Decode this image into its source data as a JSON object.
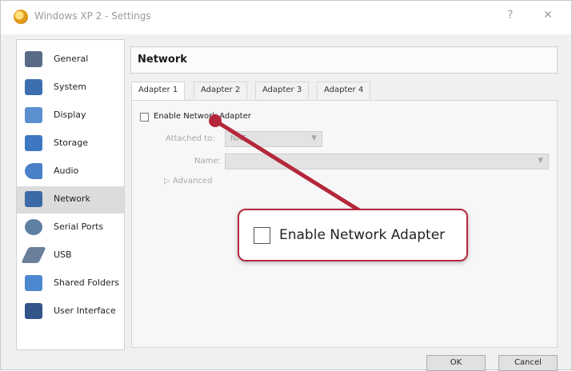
{
  "window": {
    "title": "Windows XP 2 - Settings",
    "help_glyph": "?",
    "close_glyph": "✕"
  },
  "sidebar": {
    "items": [
      {
        "label": "General",
        "icon": "general-icon",
        "color": "#5a6b86"
      },
      {
        "label": "System",
        "icon": "system-icon",
        "color": "#3d6fb0"
      },
      {
        "label": "Display",
        "icon": "display-icon",
        "color": "#5b8fcf"
      },
      {
        "label": "Storage",
        "icon": "storage-icon",
        "color": "#3f78c2"
      },
      {
        "label": "Audio",
        "icon": "audio-icon",
        "color": "#4a80c8"
      },
      {
        "label": "Network",
        "icon": "network-icon",
        "color": "#3c6aa8",
        "active": true
      },
      {
        "label": "Serial Ports",
        "icon": "serial-ports-icon",
        "color": "#5f7fa3"
      },
      {
        "label": "USB",
        "icon": "usb-icon",
        "color": "#6a7f99"
      },
      {
        "label": "Shared Folders",
        "icon": "shared-folders-icon",
        "color": "#4b88cf"
      },
      {
        "label": "User Interface",
        "icon": "user-interface-icon",
        "color": "#34558a"
      }
    ]
  },
  "header": {
    "title": "Network"
  },
  "tabs": [
    {
      "label": "Adapter 1",
      "active": true
    },
    {
      "label": "Adapter 2"
    },
    {
      "label": "Adapter 3"
    },
    {
      "label": "Adapter 4"
    }
  ],
  "adapter": {
    "enable_label": "Enable Network Adapter",
    "enabled": false,
    "attached_to_label": "Attached to:",
    "attached_to_value": "NAT",
    "name_label": "Name:",
    "name_value": "",
    "advanced_label": "Advanced"
  },
  "callout": {
    "label": "Enable Network Adapter"
  },
  "buttons": {
    "ok": "OK",
    "cancel": "Cancel"
  },
  "colors": {
    "accent_red": "#b5273b",
    "selected": "#dcdcdc"
  }
}
